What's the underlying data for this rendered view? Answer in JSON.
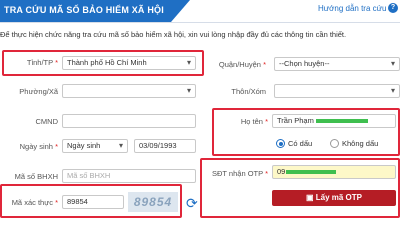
{
  "header": {
    "title": "TRA CỨU MÃ SỐ BẢO HIỂM XÃ HỘI",
    "help_link": "Hướng dẫn tra cứu"
  },
  "instruction": "Để thực hiện chức năng tra cứu mã số bảo hiểm xã hội, xin vui lòng nhập đầy đủ các thông tin cần thiết.",
  "form": {
    "province": {
      "label": "Tỉnh/TP",
      "value": "Thành phố Hồ Chí Minh"
    },
    "district": {
      "label": "Quận/Huyện",
      "value": "--Chọn huyện--"
    },
    "ward": {
      "label": "Phường/Xã"
    },
    "hamlet": {
      "label": "Thôn/Xóm"
    },
    "id_number": {
      "label": "CMND"
    },
    "birth": {
      "label": "Ngày sinh",
      "type_value": "Ngày sinh",
      "date_value": "03/09/1993"
    },
    "insurance_code": {
      "label": "Mã số BHXH",
      "placeholder": "Mã số BHXH"
    },
    "captcha": {
      "label": "Mã xác thực",
      "value": "89854",
      "image_text": "89854"
    },
    "full_name": {
      "label": "Họ tên",
      "value": "Trần Phạm"
    },
    "accent": {
      "with_accent": "Có dấu",
      "without_accent": "Không dấu"
    },
    "otp_phone": {
      "label": "SĐT nhận OTP",
      "value": "09"
    },
    "otp_button": "Lấy mã OTP"
  },
  "colors": {
    "brand_blue": "#1f6fc4",
    "highlight_red": "#e0263a",
    "button_red": "#b51d25"
  }
}
